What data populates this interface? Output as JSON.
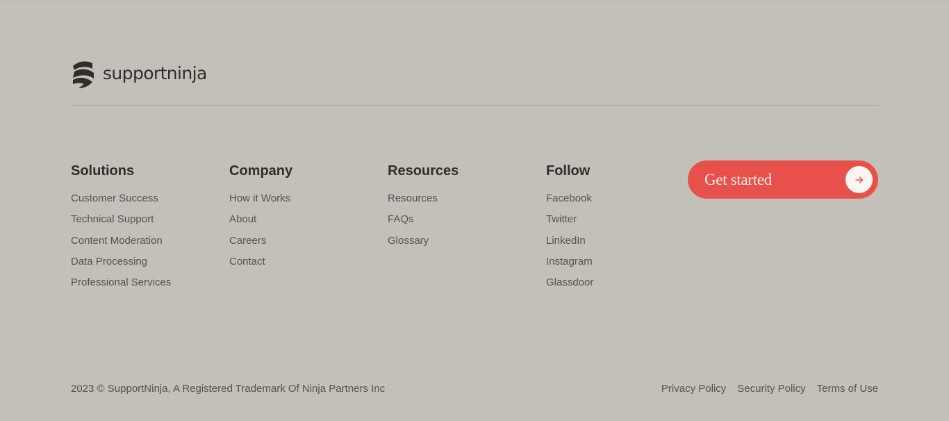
{
  "brand": {
    "name": "supportninja",
    "logo_icon": "ninja-logo-icon"
  },
  "columns": {
    "solutions": {
      "heading": "Solutions",
      "items": [
        "Customer Success",
        "Technical Support",
        "Content Moderation",
        "Data Processing",
        "Professional Services"
      ]
    },
    "company": {
      "heading": "Company",
      "items": [
        "How it Works",
        "About",
        "Careers",
        "Contact"
      ]
    },
    "resources": {
      "heading": "Resources",
      "items": [
        "Resources",
        "FAQs",
        "Glossary"
      ]
    },
    "follow": {
      "heading": "Follow",
      "items": [
        "Facebook",
        "Twitter",
        "LinkedIn",
        "Instagram",
        "Glassdoor"
      ]
    }
  },
  "cta": {
    "label": "Get started",
    "icon": "arrow-right-icon"
  },
  "footer": {
    "copyright": "2023 © SupportNinja, A Registered Trademark Of Ninja Partners Inc",
    "links": [
      "Privacy Policy",
      "Security Policy",
      "Terms of Use"
    ]
  },
  "colors": {
    "background": "#c2c0b8",
    "accent": "#e8504c",
    "text": "#2f2e2b"
  }
}
